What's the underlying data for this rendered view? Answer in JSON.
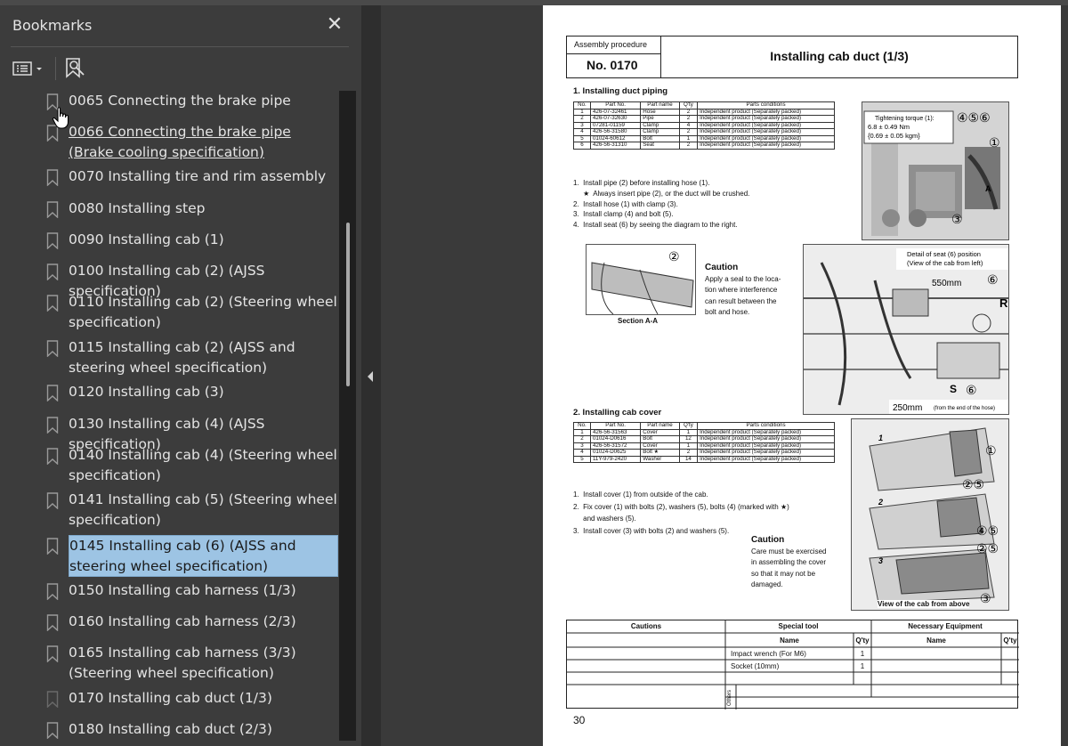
{
  "sidebar": {
    "title": "Bookmarks",
    "close_glyph": "✕",
    "items": [
      {
        "label": "0065 Connecting the brake pipe"
      },
      {
        "label": "0066 Connecting the brake pipe (Brake cooling specification)"
      },
      {
        "label": "0070 Installing tire and rim assembly"
      },
      {
        "label": "0080 Installing step"
      },
      {
        "label": "0090 Installing cab (1)"
      },
      {
        "label": "0100 Installing cab (2) (AJSS specification)"
      },
      {
        "label": "0110 Installing cab (2) (Steering wheel specification)"
      },
      {
        "label": "0115 Installing cab (2) (AJSS and steering wheel specification)"
      },
      {
        "label": "0120 Installing cab (3)"
      },
      {
        "label": "0130 Installing cab (4) (AJSS specification)"
      },
      {
        "label": "0140 Installing cab (4) (Steering wheel specification)"
      },
      {
        "label": "0141 Installing cab (5) (Steering wheel specification)"
      },
      {
        "label": "0145 Installing cab (6) (AJSS and steering wheel specification)"
      },
      {
        "label": "0150 Installing cab harness (1/3)"
      },
      {
        "label": "0160 Installing cab harness (2/3)"
      },
      {
        "label": "0165 Installing cab harness (3/3) (Steering wheel specification)"
      },
      {
        "label": "0170 Installing cab duct (1/3)"
      },
      {
        "label": "0180 Installing cab duct (2/3)"
      }
    ]
  },
  "document": {
    "header": {
      "procedure_label": "Assembly procedure",
      "number": "No. 0170",
      "title": "Installing cab duct (1/3)"
    },
    "section1": {
      "heading": "1.  Installing duct piping",
      "columns": [
        "No.",
        "Part No.",
        "Part name",
        "Q'ty",
        "Parts conditions"
      ],
      "rows": [
        [
          "1",
          "426-07-32461",
          "Hose",
          "2",
          "Independent product (Separately packed)"
        ],
        [
          "2",
          "426-07-32630",
          "Pipe",
          "2",
          "Independent product (Separately packed)"
        ],
        [
          "3",
          "07281-01159",
          "Clamp",
          "4",
          "Independent product (Separately packed)"
        ],
        [
          "4",
          "426-56-31580",
          "Clamp",
          "2",
          "Independent product (Separately packed)"
        ],
        [
          "5",
          "01024-60612",
          "Bolt",
          "1",
          "Independent product (Separately packed)"
        ],
        [
          "6",
          "426-56-31310",
          "Seat",
          "2",
          "Independent product (Separately packed)"
        ]
      ],
      "steps": [
        "1.  Install pipe (2) before installing hose (1).",
        "     ★  Always insert pipe (2), or the duct will be crushed.",
        "2.  Install hose (1) with clamp (3).",
        "3.  Install clamp (4) and bolt (5).",
        "4.  Install seat (6) by seeing the diagram to the right."
      ],
      "torque_line1": "Tightening torque (1):",
      "torque_line2": "6.8 ± 0.49 Nm",
      "torque_line3": "{0.69 ± 0.05 kgm}",
      "section_label": "Section A-A",
      "caution_title": "Caution",
      "caution_lines": [
        "Apply a seal to the loca-",
        "tion where interference",
        "can result between the",
        "bolt and hose."
      ],
      "detail_line1": "Detail of seat (6) position",
      "detail_line2": "(View of the cab from left)",
      "dim_550": "550mm",
      "dim_250": "250mm",
      "dim_note": "(from the end of the hose)"
    },
    "section2": {
      "heading": "2.  Installing cab cover",
      "columns": [
        "No.",
        "Part No.",
        "Part name",
        "Q'ty",
        "Parts conditions"
      ],
      "rows": [
        [
          "1",
          "426-56-31563",
          "Cover",
          "1",
          "Independent product (Separately packed)"
        ],
        [
          "2",
          "01024-D0616",
          "Bolt",
          "12",
          "Independent product (Separately packed)"
        ],
        [
          "3",
          "426-56-31572",
          "Cover",
          "1",
          "Independent product (Separately packed)"
        ],
        [
          "4",
          "01024-D0625",
          "Bolt ★",
          "2",
          "Independent product (Separately packed)"
        ],
        [
          "5",
          "11Y-979-2420",
          "Washer",
          "14",
          "Independent product (Separately packed)"
        ]
      ],
      "steps": [
        "1.  Install cover (1) from outside of the cab.",
        "2.  Fix cover (1) with bolts (2), washers (5), bolts (4) (marked with ★)",
        "     and washers (5).",
        "3.  Install cover (3) with bolts (2) and washers (5)."
      ],
      "caution_title": "Caution",
      "caution_lines": [
        "Care must be exercised",
        "in assembling the cover",
        "so that it may not be",
        "damaged."
      ],
      "view_label": "View of the cab from above"
    },
    "footer_table": {
      "cautions": "Cautions",
      "special_tool": "Special tool",
      "necessary_equipment": "Necessary Equipment",
      "name": "Name",
      "qty": "Q'ty",
      "tools": [
        {
          "name": "Impact wrench (For M6)",
          "qty": "1"
        },
        {
          "name": "Socket (10mm)",
          "qty": "1"
        }
      ],
      "others": "Others"
    },
    "page_number": "30"
  }
}
